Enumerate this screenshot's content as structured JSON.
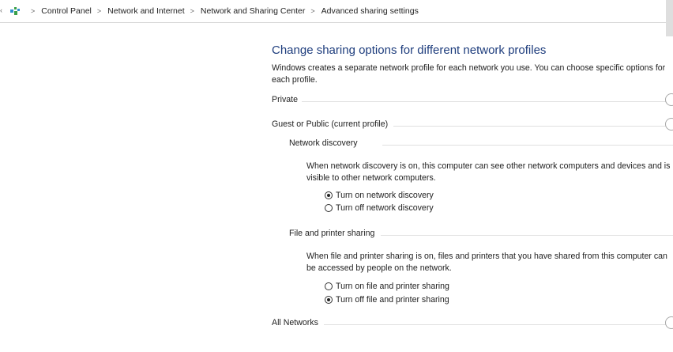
{
  "breadcrumb": {
    "items": [
      "Control Panel",
      "Network and Internet",
      "Network and Sharing Center",
      "Advanced sharing settings"
    ],
    "separator": ">"
  },
  "page": {
    "title": "Change sharing options for different network profiles",
    "intro": "Windows creates a separate network profile for each network you use. You can choose specific options for each profile."
  },
  "profiles": {
    "private": "Private",
    "guest_public": "Guest or Public (current profile)",
    "all_networks": "All Networks"
  },
  "network_discovery": {
    "heading": "Network discovery",
    "description": "When network discovery is on, this computer can see other network computers and devices and is visible to other network computers.",
    "options": [
      "Turn on network discovery",
      "Turn off network discovery"
    ],
    "selected": 0
  },
  "file_printer_sharing": {
    "heading": "File and printer sharing",
    "description": "When file and printer sharing is on, files and printers that you have shared from this computer can be accessed by people on the network.",
    "options": [
      "Turn on file and printer sharing",
      "Turn off file and printer sharing"
    ],
    "selected": 1
  },
  "icons": {
    "control_panel": "control-panel-icon",
    "collapse": "collapse-circle-icon"
  },
  "colors": {
    "title": "#1e3d7d",
    "rule": "#e0e0e0"
  }
}
